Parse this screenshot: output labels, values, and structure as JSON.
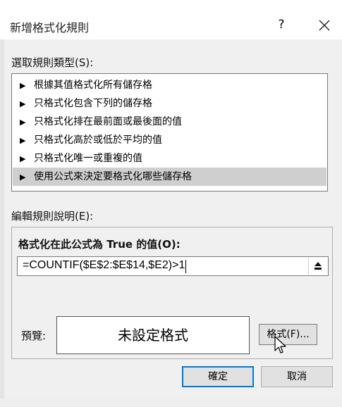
{
  "dialog": {
    "title": "新增格式化規則",
    "help_label": "?"
  },
  "rule_type": {
    "label": "選取規則類型(S):",
    "items": [
      {
        "label": "根據其值格式化所有儲存格",
        "selected": false
      },
      {
        "label": "只格式化包含下列的儲存格",
        "selected": false
      },
      {
        "label": "只格式化排在最前面或最後面的值",
        "selected": false
      },
      {
        "label": "只格式化高於或低於平均的值",
        "selected": false
      },
      {
        "label": "只格式化唯一或重複的值",
        "selected": false
      },
      {
        "label": "使用公式來決定要格式化哪些儲存格",
        "selected": true
      }
    ]
  },
  "description": {
    "label": "編輯規則說明(E):",
    "formula_label": "格式化在此公式為 True 的值(O):",
    "formula_value": "=COUNTIF($E$2:$E$14,$E2)>1",
    "preview_label": "預覽:",
    "preview_text": "未設定格式",
    "format_button": "格式(F)..."
  },
  "buttons": {
    "ok": "確定",
    "cancel": "取消"
  },
  "colors": {
    "selected_row": "#cfcfcf",
    "default_button_border": "#0078d7"
  },
  "icons": [
    "close-icon",
    "triangle-right-icon",
    "collapse-dialog-icon",
    "mouse-pointer-icon"
  ]
}
